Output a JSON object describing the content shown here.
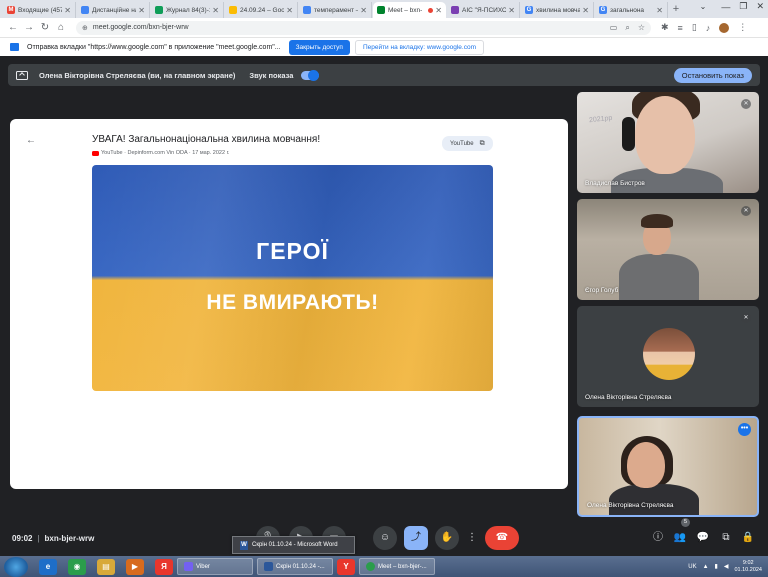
{
  "browser": {
    "tabs": [
      {
        "label": "Входящие (457)",
        "favicon": "gmail-icon",
        "color": "#ea4335",
        "active": false
      },
      {
        "label": "Дистанційне нав",
        "favicon": "classroom-icon",
        "color": "#4285f4",
        "active": false
      },
      {
        "label": "Журнал 84(3)-1",
        "favicon": "sheets-icon",
        "color": "#0f9d58",
        "active": false
      },
      {
        "label": "24.09.24 – Goog",
        "favicon": "drive-icon",
        "color": "#fbbc04",
        "active": false
      },
      {
        "label": "темперамент –",
        "favicon": "docs-icon",
        "color": "#4285f4",
        "active": false
      },
      {
        "label": "Meet – bxn-",
        "favicon": "meet-icon",
        "color": "#00832d",
        "active": true
      },
      {
        "label": "АІС \"Я-ПСИХОЛ",
        "favicon": "ais-icon",
        "color": "#7b3fb2",
        "active": false
      },
      {
        "label": "хвилина мовчан",
        "favicon": "google-icon",
        "color": "#4285f4",
        "active": false
      },
      {
        "label": "загальнона",
        "favicon": "google-icon",
        "color": "#4285f4",
        "active": false
      }
    ],
    "url": "meet.google.com/bxn-bjer-wrw"
  },
  "sharebar": {
    "message": "Отправка вкладки \"https://www.google.com\" в приложение \"meet.google.com\"...",
    "close_label": "Закрыть доступ",
    "goto_label": "Перейти на вкладку: www.google.com"
  },
  "presentation": {
    "presenter": "Олена Вікторівна Стреляєва (ви, на главном экране)",
    "sound_label": "Звук показа",
    "stop_label": "Остановить показ"
  },
  "video": {
    "title": "УВАГА! Загальнонаціональна хвилина мовчання!",
    "meta": "YouTube · Depinform.com Vin ODA · 17 мар. 2022 г.",
    "youtube_label": "YouTube",
    "flag_line1": "ГЕРОЇ",
    "flag_line2": "НЕ ВМИРАЮТЬ!"
  },
  "participants": [
    {
      "name": "Владислав Бистров",
      "muted": true
    },
    {
      "name": "Єгор Голуб",
      "muted": true
    },
    {
      "name": "Олена Вікторівна Стреляєва",
      "muted": true
    },
    {
      "name": "Олена Вікторівна Стреляєва",
      "muted": false
    }
  ],
  "tile_watermark": "2021рр",
  "meeting": {
    "time": "09:02",
    "code": "bxn-bjer-wrw",
    "participant_count": "5"
  },
  "taskbar": {
    "popup": "Скрін 01.10.24 - Microsoft Word",
    "windows": [
      "Viber",
      "Скрін 01.10.24 -...",
      "Meet – bxn-bjer-..."
    ],
    "lang": "UK",
    "time": "9:02",
    "date": "01.10.2024"
  },
  "colors": {
    "meet_bg": "#202124",
    "accent": "#8ab4f8",
    "hangup": "#ea4335",
    "flag_blue": "#3766c2",
    "flag_yellow": "#f2b63f"
  }
}
